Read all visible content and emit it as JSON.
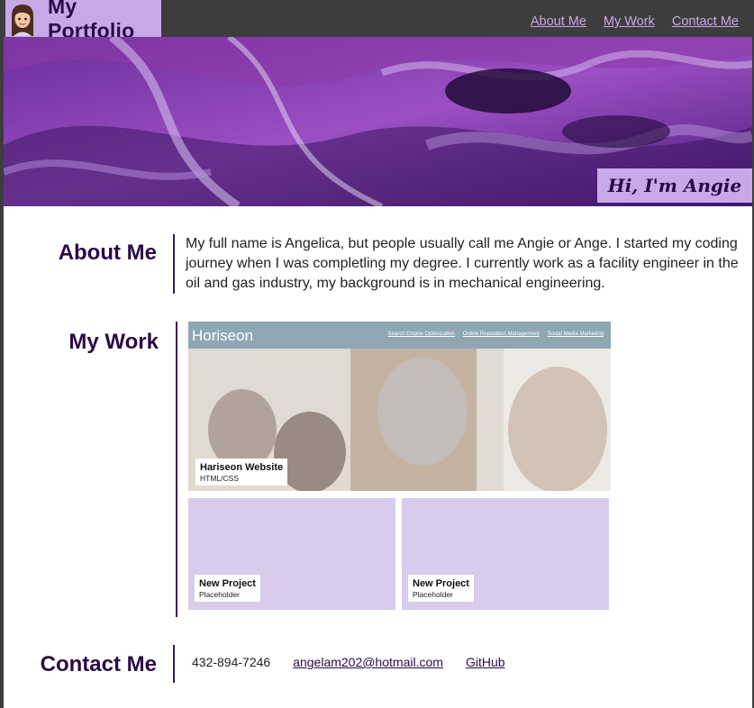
{
  "header": {
    "title": "My Portfolio",
    "nav": [
      "About Me",
      "My Work",
      "Contact Me"
    ]
  },
  "hero": {
    "tagline": "Hi, I'm Angie"
  },
  "about": {
    "heading": "About Me",
    "text": "My full name is Angelica, but people usually call me Angie or Ange. I started my coding journey when I was completling my degree. I currently work as a facility engineer in the oil and gas industry, my background is in mechanical engineering."
  },
  "work": {
    "heading": "My Work",
    "featured": {
      "site_brand": "Horiseon",
      "site_nav": [
        "Search Engine Optimization",
        "Online Reputation Management",
        "Social Media Marketing"
      ],
      "title": "Hariseon Website",
      "subtitle": "HTML/CSS"
    },
    "projects": [
      {
        "title": "New Project",
        "subtitle": "Placeholder"
      },
      {
        "title": "New Project",
        "subtitle": "Placeholder"
      }
    ]
  },
  "contact": {
    "heading": "Contact Me",
    "phone": "432-894-7246",
    "email": "angelam202@hotmail.com",
    "github": "GitHub"
  },
  "colors": {
    "accent": "#c9a8e8",
    "dark_purple": "#2a0a45",
    "header_bg": "#3d3d3d",
    "placeholder": "#d8cbec"
  }
}
